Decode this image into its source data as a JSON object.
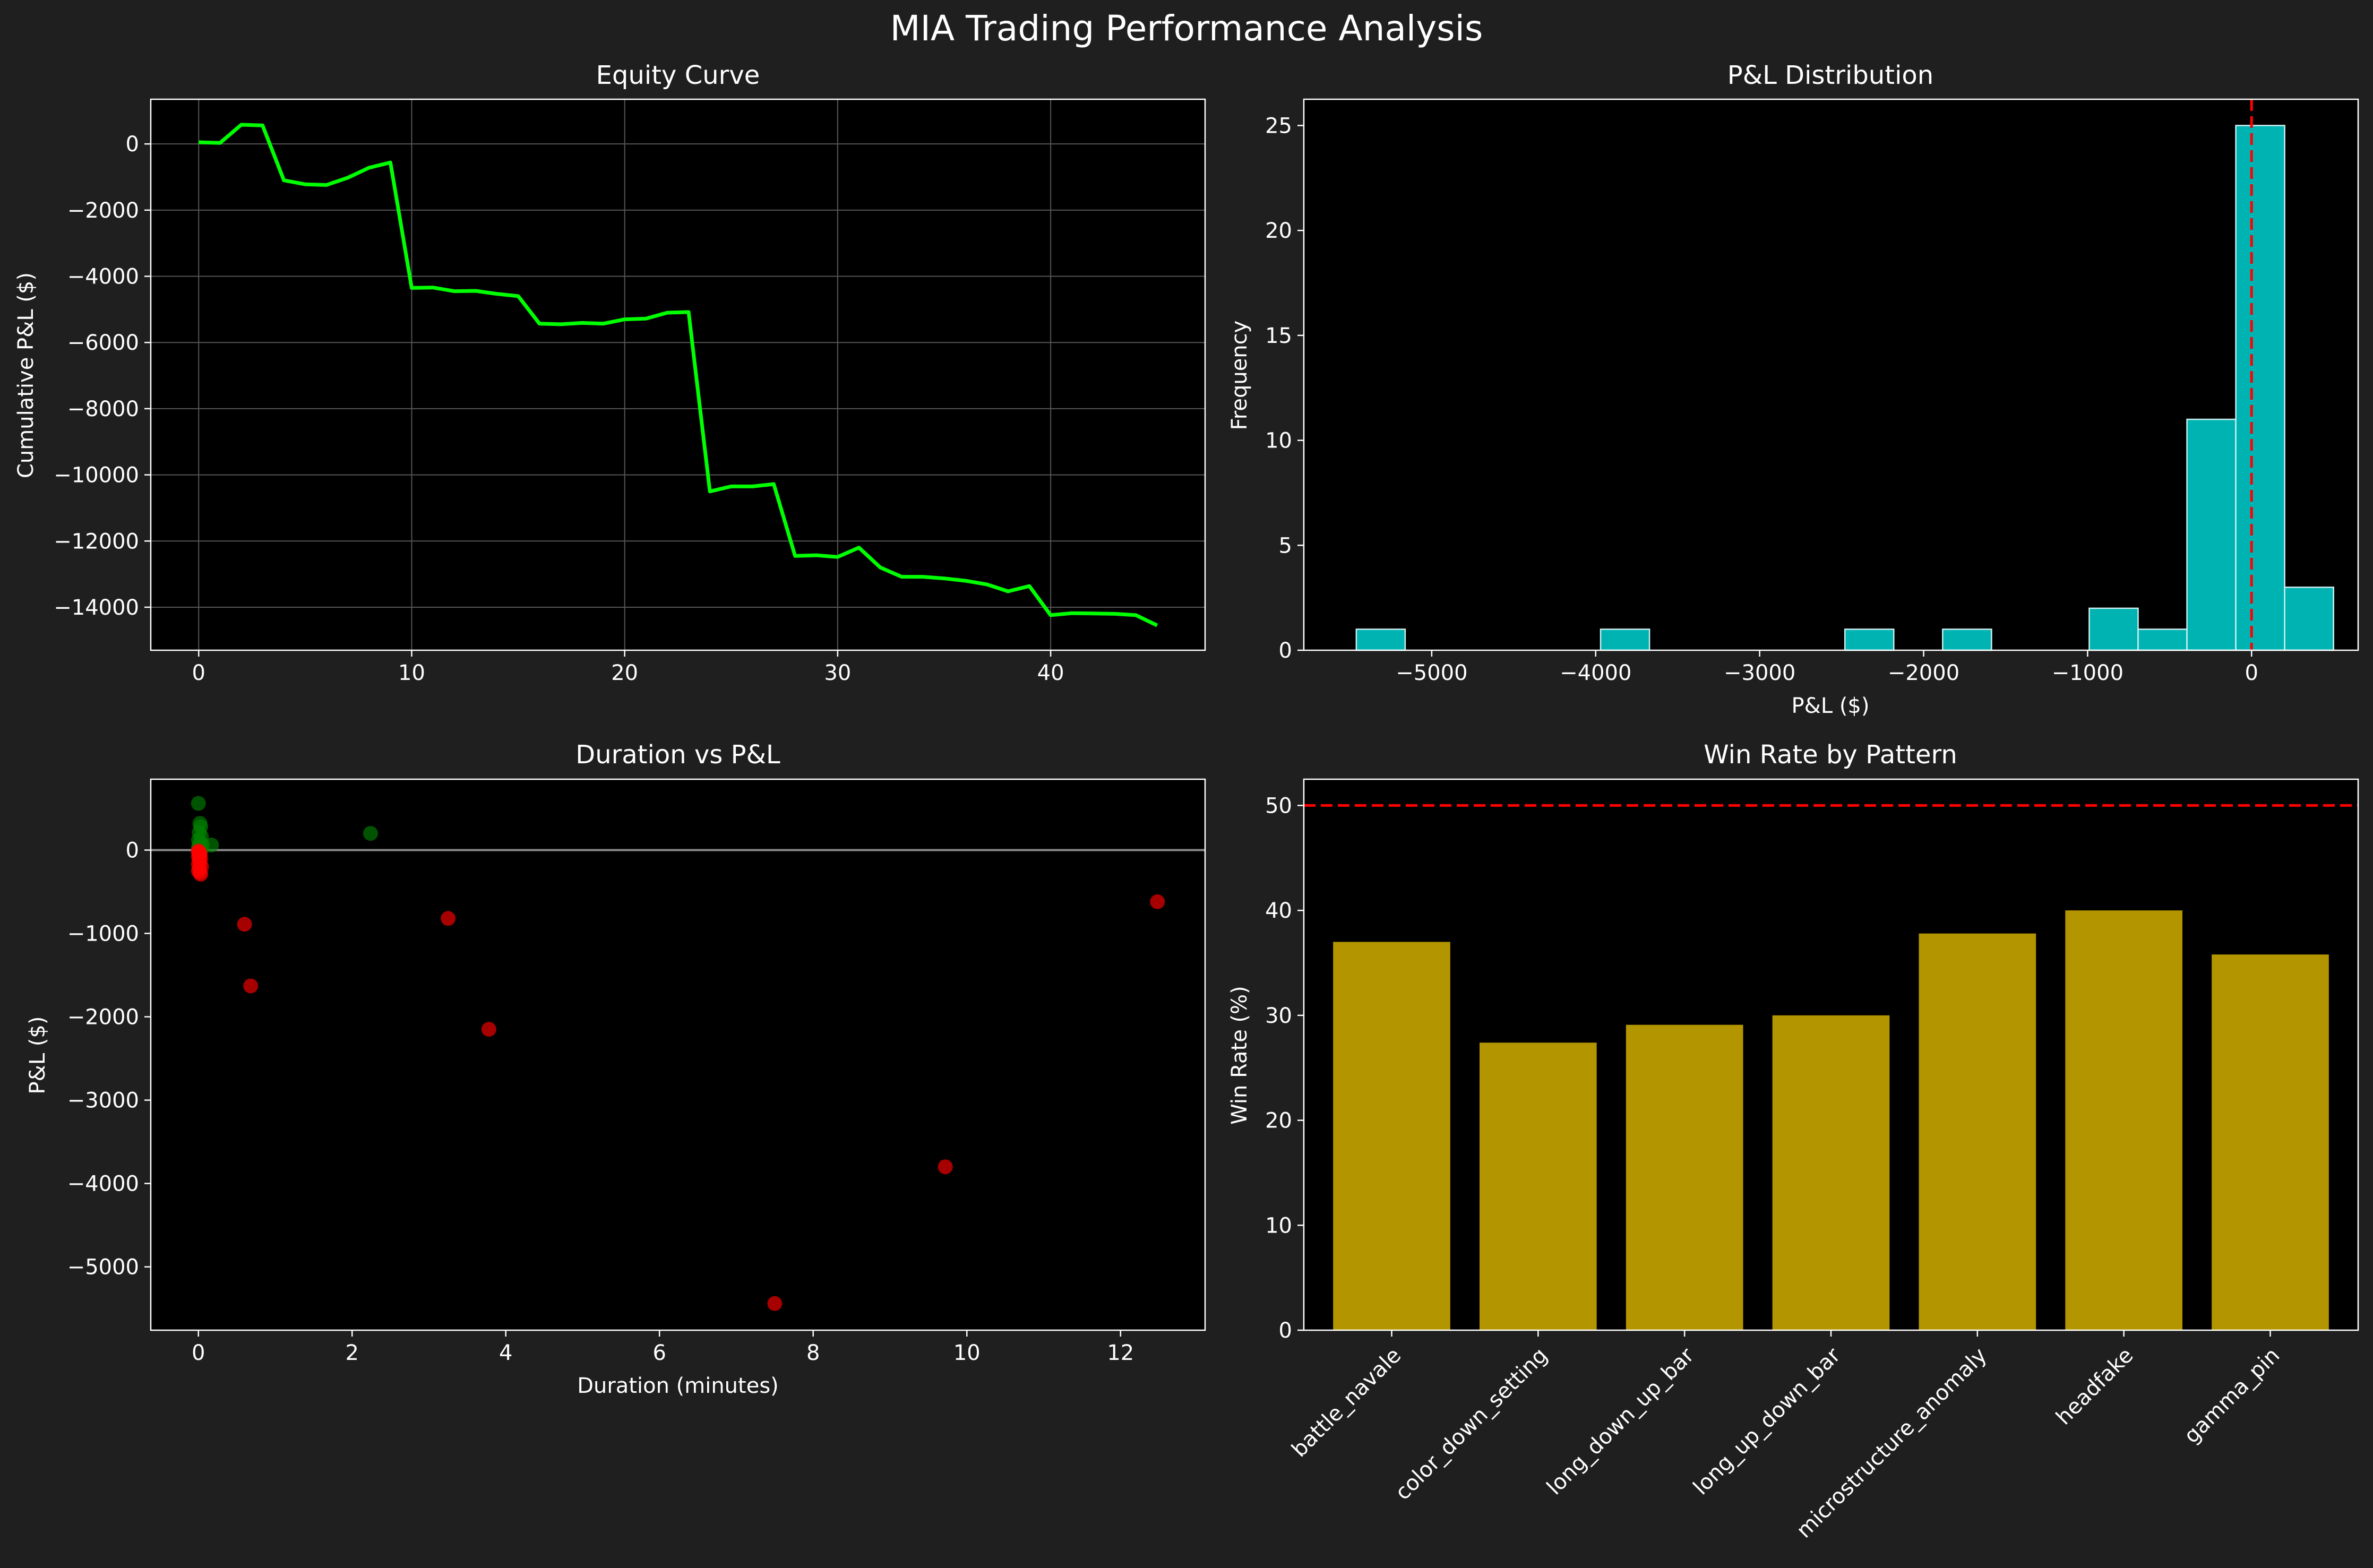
{
  "figure_title": "MIA Trading Performance Analysis",
  "colors": {
    "background": "#1f1f1f",
    "axes_bg": "#000000",
    "equity_line": "#00ff00",
    "hist_bar": "#00b3b3",
    "hist_edge": "#d0f0f0",
    "zero_line": "#ff0000",
    "win_dot": "#008000",
    "loss_dot": "#ff0000",
    "winrate_bar": "#b39500",
    "grid": "#555555"
  },
  "chart_data": [
    {
      "id": "equity",
      "type": "line",
      "title": "Equity Curve",
      "xlabel": "",
      "ylabel": "Cumulative P&L ($)",
      "xlim": [
        -2.25,
        47.25
      ],
      "ylim": [
        -15300,
        1350
      ],
      "xticks": [
        0,
        10,
        20,
        30,
        40
      ],
      "yticks": [
        0,
        -2000,
        -4000,
        -6000,
        -8000,
        -10000,
        -12000,
        -14000
      ],
      "grid": true,
      "x": [
        0,
        1,
        2,
        3,
        4,
        5,
        6,
        7,
        8,
        9,
        10,
        11,
        12,
        13,
        14,
        15,
        16,
        17,
        18,
        19,
        20,
        21,
        22,
        23,
        24,
        25,
        26,
        27,
        28,
        29,
        30,
        31,
        32,
        33,
        34,
        35,
        36,
        37,
        38,
        39,
        40,
        41,
        42,
        43,
        44,
        45
      ],
      "y": [
        50,
        30,
        580,
        560,
        -1100,
        -1220,
        -1240,
        -1020,
        -720,
        -560,
        -4350,
        -4340,
        -4450,
        -4440,
        -4530,
        -4600,
        -5430,
        -5450,
        -5410,
        -5430,
        -5300,
        -5280,
        -5100,
        -5080,
        -10500,
        -10350,
        -10350,
        -10280,
        -12450,
        -12430,
        -12480,
        -12200,
        -12800,
        -13080,
        -13080,
        -13130,
        -13200,
        -13310,
        -13520,
        -13360,
        -14240,
        -14180,
        -14190,
        -14200,
        -14240,
        -14550
      ]
    },
    {
      "id": "distribution",
      "type": "bar",
      "title": "P&L Distribution",
      "xlabel": "P&L ($)",
      "ylabel": "Frequency",
      "xlim": [
        -5780,
        650
      ],
      "ylim": [
        0,
        26.25
      ],
      "xticks": [
        -5000,
        -4000,
        -3000,
        -2000,
        -1000,
        0
      ],
      "yticks": [
        0,
        5,
        10,
        15,
        20,
        25
      ],
      "bin_edges": [
        -5460,
        -5162,
        -4864,
        -4566,
        -4268,
        -3970,
        -3672,
        -3374,
        -3076,
        -2778,
        -2480,
        -2182,
        -1884,
        -1586,
        -1288,
        -990,
        -692,
        -394,
        -96,
        202,
        500
      ],
      "counts": [
        1,
        0,
        0,
        0,
        0,
        1,
        0,
        0,
        0,
        0,
        1,
        0,
        1,
        0,
        0,
        2,
        1,
        11,
        25,
        3
      ],
      "reference_line_x": 0
    },
    {
      "id": "scatter",
      "type": "scatter",
      "title": "Duration vs P&L",
      "xlabel": "Duration (minutes)",
      "ylabel": "P&L ($)",
      "xlim": [
        -0.62,
        13.1
      ],
      "ylim": [
        -5760,
        850
      ],
      "xticks": [
        0,
        2,
        4,
        6,
        8,
        10,
        12
      ],
      "yticks": [
        0,
        -1000,
        -2000,
        -3000,
        -4000,
        -5000
      ],
      "reference_line_y": 0,
      "wins": {
        "x": [
          0.0,
          0.02,
          0.03,
          0.01,
          0.04,
          0.0,
          0.02,
          0.05,
          0.01,
          0.03,
          0.0,
          0.02,
          0.04,
          0.01,
          0.17,
          2.24
        ],
        "y": [
          560,
          320,
          280,
          210,
          160,
          120,
          90,
          70,
          50,
          40,
          30,
          20,
          10,
          5,
          60,
          200
        ]
      },
      "losses": {
        "x": [
          0.0,
          0.01,
          0.02,
          0.0,
          0.03,
          0.01,
          0.02,
          0.0,
          0.04,
          0.01,
          0.0,
          0.02,
          0.03,
          0.0,
          0.01,
          0.02,
          0.6,
          0.68,
          3.25,
          3.78,
          7.5,
          9.72,
          12.48
        ],
        "y": [
          -10,
          -30,
          -50,
          -80,
          -100,
          -120,
          -150,
          -170,
          -200,
          -220,
          -250,
          -270,
          -290,
          -20,
          -60,
          -40,
          -890,
          -1630,
          -820,
          -2150,
          -5440,
          -3800,
          -620
        ]
      }
    },
    {
      "id": "winrate",
      "type": "bar",
      "title": "Win Rate by Pattern",
      "xlabel": "",
      "ylabel": "Win Rate (%)",
      "ylim": [
        0,
        52.5
      ],
      "yticks": [
        0,
        10,
        20,
        30,
        40,
        50
      ],
      "categories": [
        "battle_navale",
        "color_down_setting",
        "long_down_up_bar",
        "long_up_down_bar",
        "microstructure_anomaly",
        "headfake",
        "gamma_pin"
      ],
      "values": [
        37.0,
        27.4,
        29.1,
        30.0,
        37.8,
        40.0,
        35.8
      ],
      "reference_line_y": 50
    }
  ]
}
